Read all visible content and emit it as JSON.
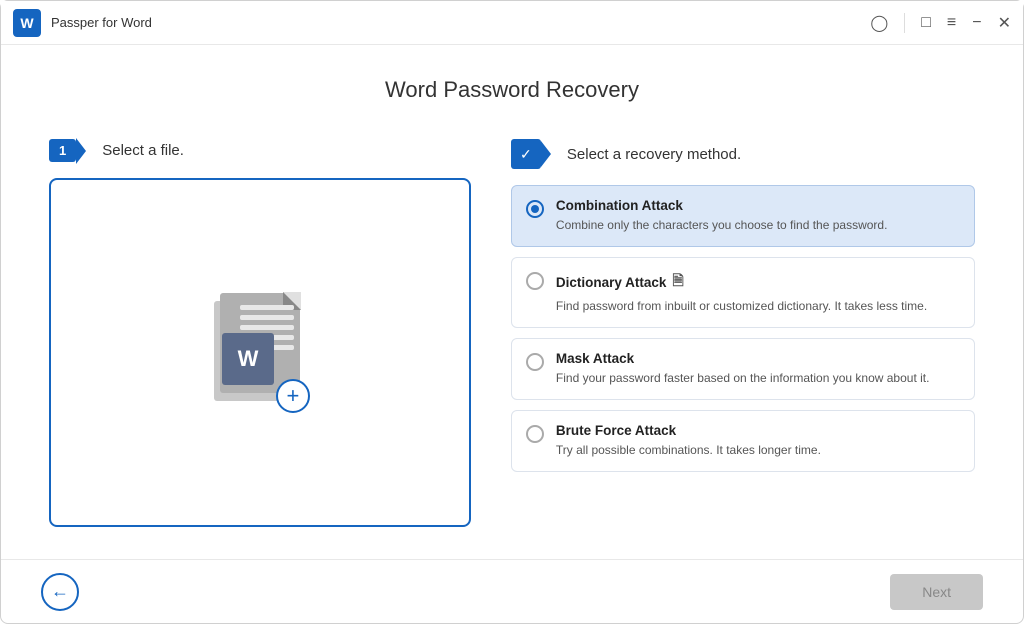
{
  "titlebar": {
    "logo_text": "W",
    "title": "Passper for Word",
    "icons": [
      "account",
      "chat",
      "menu",
      "minimize",
      "close"
    ]
  },
  "page": {
    "title": "Word Password Recovery"
  },
  "step1": {
    "badge": "1",
    "label": "Select a file."
  },
  "step2": {
    "label": "Select a recovery method."
  },
  "methods": [
    {
      "id": "combination",
      "name": "Combination Attack",
      "desc": "Combine only the characters you choose to find the password.",
      "selected": true,
      "has_icon": false
    },
    {
      "id": "dictionary",
      "name": "Dictionary Attack",
      "desc": "Find password from inbuilt or customized dictionary. It takes less time.",
      "selected": false,
      "has_icon": true
    },
    {
      "id": "mask",
      "name": "Mask Attack",
      "desc": "Find your password faster based on the information you know about it.",
      "selected": false,
      "has_icon": false
    },
    {
      "id": "brute",
      "name": "Brute Force Attack",
      "desc": "Try all possible combinations. It takes longer time.",
      "selected": false,
      "has_icon": false
    }
  ],
  "buttons": {
    "back_label": "←",
    "next_label": "Next"
  }
}
